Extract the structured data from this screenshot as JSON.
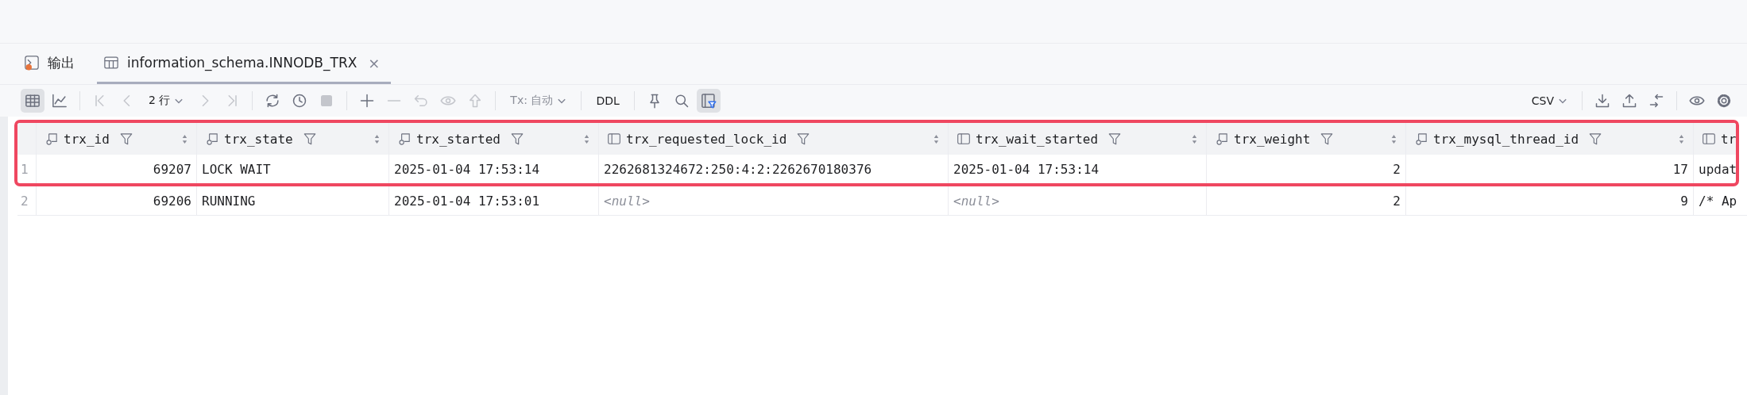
{
  "tabs": [
    {
      "label": "输出",
      "kind": "console",
      "selected": false,
      "closable": false
    },
    {
      "label": "information_schema.INNODB_TRX",
      "kind": "table",
      "selected": true,
      "closable": true,
      "close_glyph": "×"
    }
  ],
  "toolbar": {
    "left": [
      {
        "kind": "icon",
        "selected": true,
        "disabled": false
      },
      {
        "kind": "icon",
        "selected": false,
        "disabled": false
      },
      {
        "kind": "separator"
      },
      {
        "kind": "icon",
        "selected": false,
        "disabled": true
      },
      {
        "kind": "icon",
        "selected": false,
        "disabled": true
      },
      {
        "kind": "dropdown",
        "label": "2 行",
        "disabled": false
      },
      {
        "kind": "icon",
        "selected": false,
        "disabled": true
      },
      {
        "kind": "icon",
        "selected": false,
        "disabled": true
      },
      {
        "kind": "separator"
      },
      {
        "kind": "icon",
        "selected": false,
        "disabled": false
      },
      {
        "kind": "icon",
        "selected": false,
        "disabled": false
      },
      {
        "kind": "icon",
        "selected": false,
        "disabled": true
      },
      {
        "kind": "separator"
      },
      {
        "kind": "icon",
        "selected": false,
        "disabled": false
      },
      {
        "kind": "icon",
        "selected": false,
        "disabled": true
      },
      {
        "kind": "icon",
        "selected": false,
        "disabled": true
      },
      {
        "kind": "icon",
        "selected": false,
        "disabled": true
      },
      {
        "kind": "icon",
        "selected": false,
        "disabled": true
      },
      {
        "kind": "separator"
      },
      {
        "kind": "dropdown",
        "label": "Tx: 自动",
        "disabled": true
      },
      {
        "kind": "separator"
      },
      {
        "kind": "text",
        "label": "DDL"
      },
      {
        "kind": "separator"
      },
      {
        "kind": "icon",
        "selected": false,
        "disabled": false
      },
      {
        "kind": "icon",
        "selected": false,
        "disabled": false
      },
      {
        "kind": "icon",
        "selected": true,
        "disabled": false
      }
    ],
    "right": [
      {
        "kind": "dropdown",
        "label": "CSV",
        "disabled": false
      },
      {
        "kind": "separator"
      },
      {
        "kind": "icon",
        "selected": false,
        "disabled": false
      },
      {
        "kind": "icon",
        "selected": false,
        "disabled": false
      },
      {
        "kind": "icon",
        "selected": false,
        "disabled": false
      },
      {
        "kind": "separator"
      },
      {
        "kind": "icon",
        "selected": false,
        "disabled": false
      },
      {
        "kind": "icon",
        "selected": false,
        "disabled": false
      }
    ]
  },
  "table": {
    "columns": [
      {
        "name": "trx_id",
        "kind": "indexed"
      },
      {
        "name": "trx_state",
        "kind": "indexed"
      },
      {
        "name": "trx_started",
        "kind": "indexed"
      },
      {
        "name": "trx_requested_lock_id",
        "kind": "plain"
      },
      {
        "name": "trx_wait_started",
        "kind": "plain"
      },
      {
        "name": "trx_weight",
        "kind": "indexed"
      },
      {
        "name": "trx_mysql_thread_id",
        "kind": "indexed"
      },
      {
        "name": "tr",
        "kind": "plain"
      }
    ],
    "rows": [
      {
        "number": "1",
        "highlighted": true,
        "cells": [
          {
            "text": "69207",
            "null": false
          },
          {
            "text": "LOCK WAIT",
            "null": false
          },
          {
            "text": "2025-01-04 17:53:14",
            "null": false
          },
          {
            "text": "2262681324672:250:4:2:2262670180376",
            "null": false
          },
          {
            "text": "2025-01-04 17:53:14",
            "null": false
          },
          {
            "text": "2",
            "null": false
          },
          {
            "text": "17",
            "null": false
          },
          {
            "text": "updat",
            "null": false
          }
        ]
      },
      {
        "number": "2",
        "highlighted": false,
        "cells": [
          {
            "text": "69206",
            "null": false
          },
          {
            "text": "RUNNING",
            "null": false
          },
          {
            "text": "2025-01-04 17:53:01",
            "null": false
          },
          {
            "text": "<null>",
            "null": true
          },
          {
            "text": "<null>",
            "null": true
          },
          {
            "text": "2",
            "null": false
          },
          {
            "text": "9",
            "null": false
          },
          {
            "text": "/* Ap",
            "null": false
          }
        ]
      }
    ]
  }
}
